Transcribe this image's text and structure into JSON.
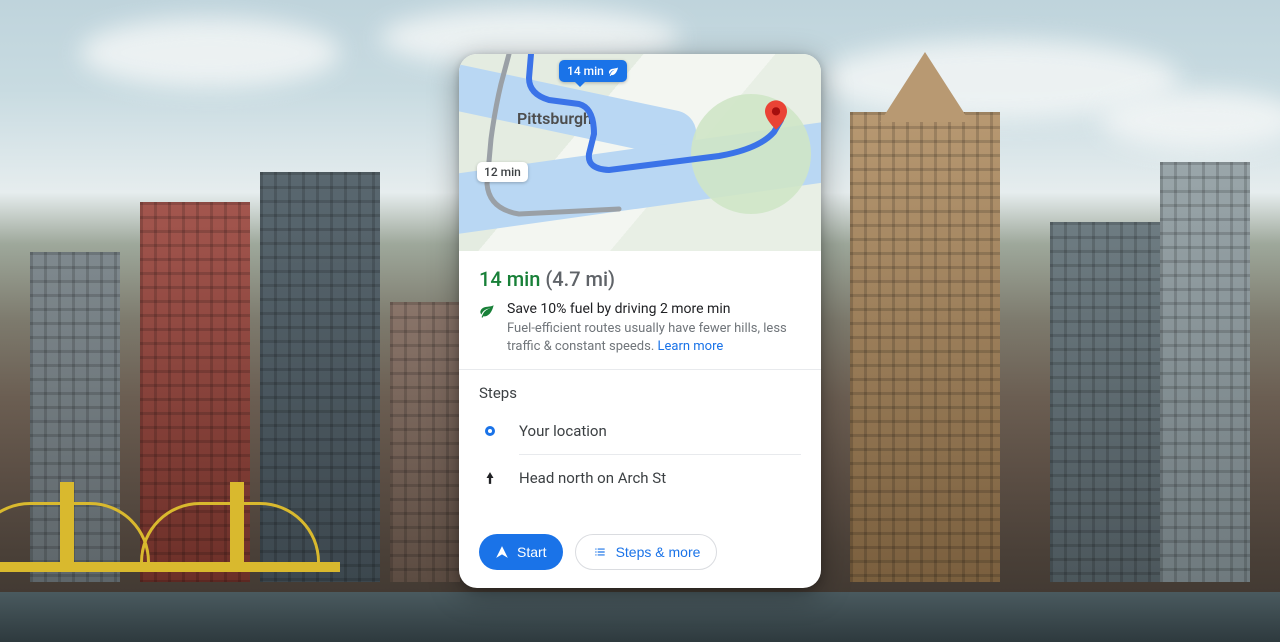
{
  "map": {
    "city_label": "Pittsburgh",
    "main_route_badge": "14 min",
    "alt_route_badge": "12 min"
  },
  "summary": {
    "duration": "14 min",
    "distance": "(4.7 mi)"
  },
  "eco": {
    "title": "Save 10% fuel by driving 2 more min",
    "description": "Fuel-efficient routes usually have fewer hills, less traffic & constant speeds. ",
    "learn_more": "Learn more"
  },
  "steps": {
    "header": "Steps",
    "items": [
      {
        "label": "Your location"
      },
      {
        "label": "Head north on Arch St"
      }
    ]
  },
  "footer": {
    "start": "Start",
    "steps_more": "Steps & more"
  }
}
